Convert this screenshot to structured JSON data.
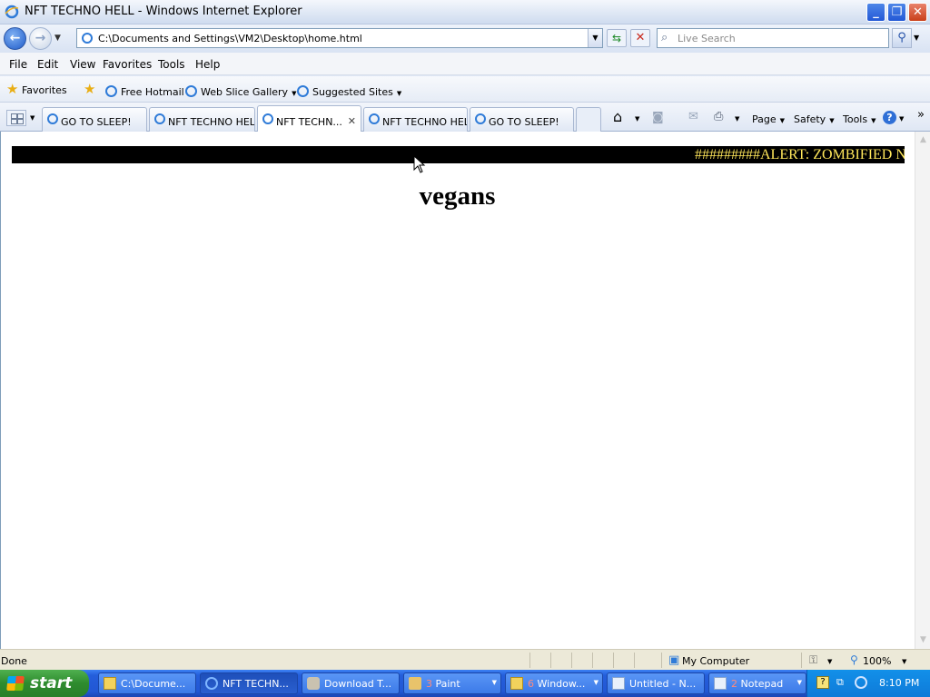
{
  "window": {
    "title": "NFT TECHNO HELL - Windows Internet Explorer",
    "controls": {
      "minimize": "_",
      "maximize": "❐",
      "close": "✕"
    }
  },
  "address_bar": {
    "url": "C:\\Documents and Settings\\VM2\\Desktop\\home.html",
    "search_placeholder": "Live Search"
  },
  "menu": {
    "items": [
      "File",
      "Edit",
      "View",
      "Favorites",
      "Tools",
      "Help"
    ]
  },
  "favorites_bar": {
    "favorites_label": "Favorites",
    "links": [
      "Free Hotmail",
      "Web Slice Gallery",
      "Suggested Sites"
    ]
  },
  "tabs": [
    {
      "label": "GO TO SLEEP!",
      "active": false
    },
    {
      "label": "NFT TECHNO HELL",
      "active": false
    },
    {
      "label": "NFT TECHN...",
      "active": true
    },
    {
      "label": "NFT TECHNO HELL",
      "active": false
    },
    {
      "label": "GO TO SLEEP!",
      "active": false
    }
  ],
  "command_bar": {
    "page": "Page",
    "safety": "Safety",
    "tools": "Tools",
    "overflow": "»"
  },
  "page": {
    "marquee_text": "#########ALERT: ZOMBIFIED NI",
    "heading": "vegans"
  },
  "status_bar": {
    "status": "Done",
    "zone": "My Computer",
    "zoom": "100%"
  },
  "taskbar": {
    "start_label": "start",
    "tasks": [
      {
        "label": "C:\\Docume...",
        "count": ""
      },
      {
        "label": "NFT TECHN...",
        "count": ""
      },
      {
        "label": "Download T...",
        "count": ""
      },
      {
        "label": "Paint",
        "count": "3"
      },
      {
        "label": "Window...",
        "count": "6"
      },
      {
        "label": "Untitled - N...",
        "count": ""
      },
      {
        "label": "Notepad",
        "count": "2"
      }
    ],
    "clock": "8:10 PM"
  },
  "colors": {
    "marquee_bg": "#000000",
    "marquee_text": "#ffe75b",
    "taskbar": "#245edb",
    "start_button": "#2e8b2e"
  }
}
